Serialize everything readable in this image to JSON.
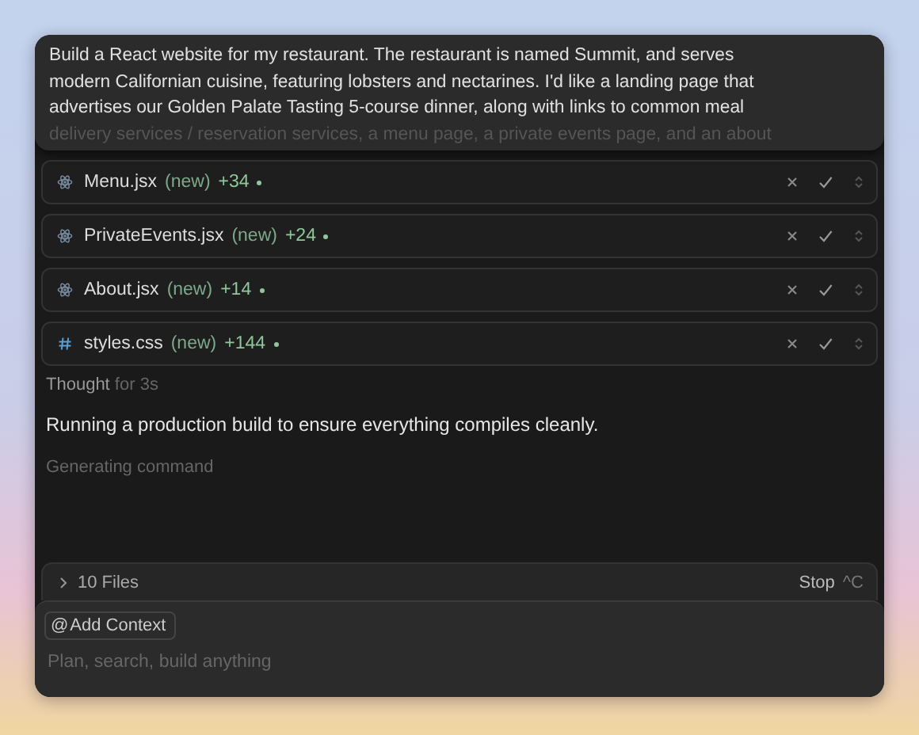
{
  "prompt": {
    "lines": [
      "Build a React website for my restaurant. The restaurant is named Summit, and serves",
      "modern Californian cuisine, featuring lobsters and nectarines. I'd like a landing page that",
      "advertises our Golden Palate Tasting 5-course dinner, along with links to common meal"
    ],
    "faded_line": "delivery services / reservation services, a menu page, a private events page, and an about"
  },
  "files": [
    {
      "kind": "jsx",
      "name": "Menu.jsx",
      "status": "(new)",
      "additions": "+34"
    },
    {
      "kind": "jsx",
      "name": "PrivateEvents.jsx",
      "status": "(new)",
      "additions": "+24"
    },
    {
      "kind": "jsx",
      "name": "About.jsx",
      "status": "(new)",
      "additions": "+14"
    },
    {
      "kind": "css",
      "name": "styles.css",
      "status": "(new)",
      "additions": "+144"
    }
  ],
  "thought": {
    "label": "Thought",
    "duration": "for 3s"
  },
  "message": "Running a production build to ensure everything compiles cleanly.",
  "progress": "Generating command",
  "files_bar": {
    "expanded": false,
    "label": "10 Files",
    "stop": "Stop",
    "shortcut": "^C"
  },
  "composer": {
    "add_context": "Add Context",
    "at": "@",
    "placeholder": "Plan, search, build anything"
  }
}
